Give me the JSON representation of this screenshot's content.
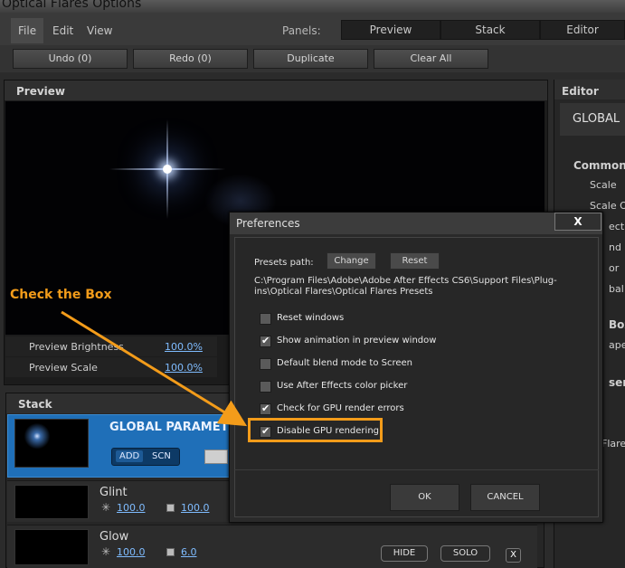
{
  "window": {
    "title": "Optical Flares Options"
  },
  "menu": {
    "items": [
      "File",
      "Edit",
      "View"
    ],
    "panels_label": "Panels:",
    "panel_buttons": [
      "Preview",
      "Stack",
      "Editor"
    ]
  },
  "toolbar": {
    "undo": "Undo (0)",
    "redo": "Redo (0)",
    "duplicate": "Duplicate",
    "clear_all": "Clear All"
  },
  "preview": {
    "title": "Preview",
    "brightness_label": "Preview Brightness",
    "brightness_value": "100.0%",
    "scale_label": "Preview Scale",
    "scale_value": "100.0%"
  },
  "stack": {
    "title": "Stack",
    "global_title": "GLOBAL PARAMETE",
    "add_label": "ADD",
    "scn_label": "SCN",
    "layers": [
      {
        "name": "Glint",
        "brightness": "100.0",
        "scale": "100.0"
      },
      {
        "name": "Glow",
        "brightness": "100.0",
        "scale": "6.0"
      }
    ],
    "hide_label": "HIDE",
    "solo_label": "SOLO",
    "remove_label": "X"
  },
  "editor": {
    "title": "Editor",
    "global_label": "GLOBAL",
    "common_label": "Common",
    "items": [
      "Scale",
      "Scale O",
      "ect F",
      "nd M",
      "or",
      "bal S"
    ],
    "box_label": "Box",
    "ape_label": "ape",
    "ser_label": "ser",
    "flare_label": "Flare"
  },
  "dialog": {
    "title": "Preferences",
    "close_label": "X",
    "presets_path_label": "Presets path:",
    "change_label": "Change",
    "reset_label": "Reset",
    "path_line1": "C:\\Program Files\\Adobe\\Adobe After Effects CS6\\Support Files\\Plug-",
    "path_line2": "ins\\Optical Flares\\Optical Flares Presets",
    "options": [
      {
        "label": "Reset windows",
        "checked": false
      },
      {
        "label": "Show animation in preview window",
        "checked": true
      },
      {
        "label": "Default blend mode to Screen",
        "checked": false
      },
      {
        "label": "Use After Effects color picker",
        "checked": false
      },
      {
        "label": "Check for GPU render errors",
        "checked": true
      },
      {
        "label": "Disable GPU rendering",
        "checked": true
      }
    ],
    "ok_label": "OK",
    "cancel_label": "CANCEL"
  },
  "annotation": {
    "text": "Check the Box",
    "color": "#f39c1a"
  }
}
